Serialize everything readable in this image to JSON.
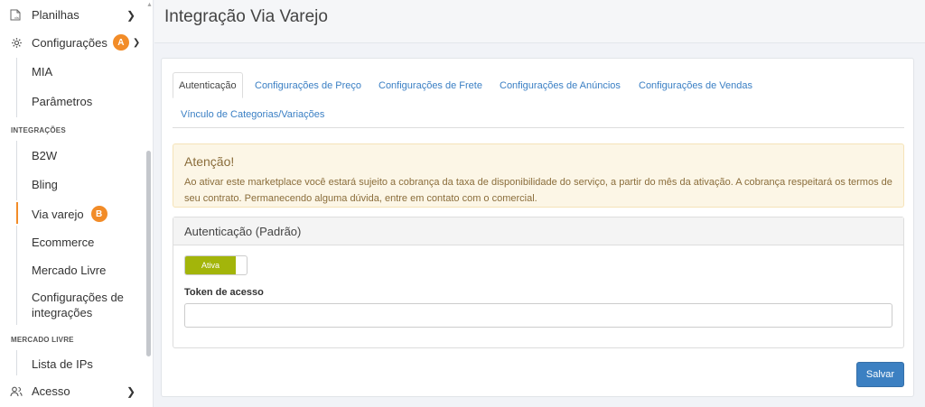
{
  "sidebar": {
    "planilhas": {
      "label": "Planilhas",
      "icon": "spreadsheet-icon"
    },
    "configuracoes": {
      "label": "Configurações",
      "badge": "A",
      "icon": "gear-icon"
    },
    "config_items": [
      {
        "label": "MIA"
      },
      {
        "label": "Parâmetros"
      }
    ],
    "integracoes_header": "INTEGRAÇÕES",
    "integracoes_items": [
      {
        "label": "B2W"
      },
      {
        "label": "Bling"
      },
      {
        "label": "Via varejo",
        "badge": "B",
        "active": true
      },
      {
        "label": "Ecommerce"
      },
      {
        "label": "Mercado Livre"
      },
      {
        "label": "Configurações de",
        "label2": "integrações"
      }
    ],
    "mercado_livre_header": "MERCADO LIVRE",
    "mercado_livre_items": [
      {
        "label": "Lista de IPs"
      }
    ],
    "acesso": {
      "label": "Acesso",
      "icon": "users-icon"
    }
  },
  "header": {
    "title": "Integração Via Varejo"
  },
  "tabs": [
    {
      "label": "Autenticação",
      "active": true
    },
    {
      "label": "Configurações de Preço"
    },
    {
      "label": "Configurações de Frete"
    },
    {
      "label": "Configurações de Anúncios"
    },
    {
      "label": "Configurações de Vendas"
    },
    {
      "label": "Vínculo de Categorias/Variações"
    }
  ],
  "alert": {
    "title": "Atenção!",
    "text": "Ao ativar este marketplace você estará sujeito a cobrança da taxa de disponibilidade do serviço, a partir do mês da ativação. A cobrança respeitará os termos de seu contrato. Permanecendo alguma dúvida, entre em contato com o comercial."
  },
  "panel": {
    "title": "Autenticação (Padrão)",
    "toggle_label": "Ativa",
    "token_label": "Token de acesso",
    "token_value": "",
    "token_placeholder": ""
  },
  "save_label": "Salvar",
  "colors": {
    "accent": "#3c80c2",
    "badge": "#f28c28",
    "toggle_on": "#a3b50a",
    "alert_bg": "#fcf6e6",
    "alert_text": "#8a6d3b"
  }
}
